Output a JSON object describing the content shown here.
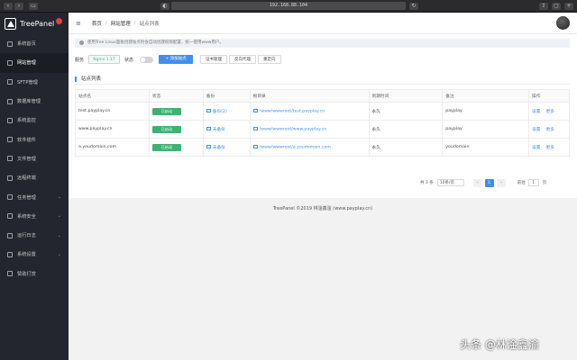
{
  "browser": {
    "url": "192.168.88.104"
  },
  "sidebar": {
    "app_name": "TreePanel",
    "items": [
      {
        "label": "系统首页",
        "active": false
      },
      {
        "label": "网站管理",
        "active": true
      },
      {
        "label": "SFTP管理",
        "active": false
      },
      {
        "label": "数据库管理",
        "active": false
      },
      {
        "label": "系统监控",
        "active": false
      },
      {
        "label": "软件插件",
        "active": false
      },
      {
        "label": "文件管理",
        "active": false
      },
      {
        "label": "远程终端",
        "active": false
      },
      {
        "label": "任务管理",
        "active": false,
        "expandable": true
      },
      {
        "label": "系统安全",
        "active": false,
        "expandable": true
      },
      {
        "label": "运行日志",
        "active": false,
        "expandable": true
      },
      {
        "label": "系统设置",
        "active": false,
        "expandable": true
      },
      {
        "label": "赞助打赏",
        "active": false
      }
    ]
  },
  "breadcrumb": {
    "home": "首页",
    "parent": "网站管理",
    "current": "站点列表"
  },
  "notice": "使用Tree Linux面板创建站点时会自动创建权限配置，统一使用www用户。",
  "toolbar": {
    "service_label": "服务",
    "nginx_version": "Nginx 1.17",
    "status_label": "状态",
    "add_site": "+ 添加站点",
    "cert_mgmt": "证书管理",
    "reverse_proxy": "反向代理",
    "redirect": "重定向"
  },
  "section_title": "站点列表",
  "table": {
    "headers": [
      "站点名",
      "状态",
      "备份",
      "根目录",
      "到期时间",
      "备注",
      "操作"
    ],
    "rows": [
      {
        "site": "test.payplay.cn",
        "status": "已启动",
        "backup": "备份(2)",
        "root": "/www/wwwroot/test.payplay.cn",
        "expire": "永久",
        "note": "payplay",
        "op1": "设置",
        "op2": "更多"
      },
      {
        "site": "www.payplay.cn",
        "status": "已启动",
        "backup": "未备份",
        "root": "/www/wwwroot/www.payplay.cn",
        "expire": "永久",
        "note": "payplay",
        "op1": "设置",
        "op2": "更多"
      },
      {
        "site": "a.youdomain.com",
        "status": "已启动",
        "backup": "未备份",
        "root": "/www/wwwroot/a.youdomain.com",
        "expire": "永久",
        "note": "youdomain",
        "op1": "设置",
        "op2": "更多"
      }
    ]
  },
  "pagination": {
    "total": "共 3 条",
    "page_size": "10条/页",
    "prev": "<",
    "current": "1",
    "next": ">",
    "goto_label": "前往",
    "goto_value": "1",
    "page_unit": "页"
  },
  "footer": "TreePanel ©2019 林淦鑫淦 (www.payplay.cn)",
  "watermark": "头条 @林淦鑫渝"
}
